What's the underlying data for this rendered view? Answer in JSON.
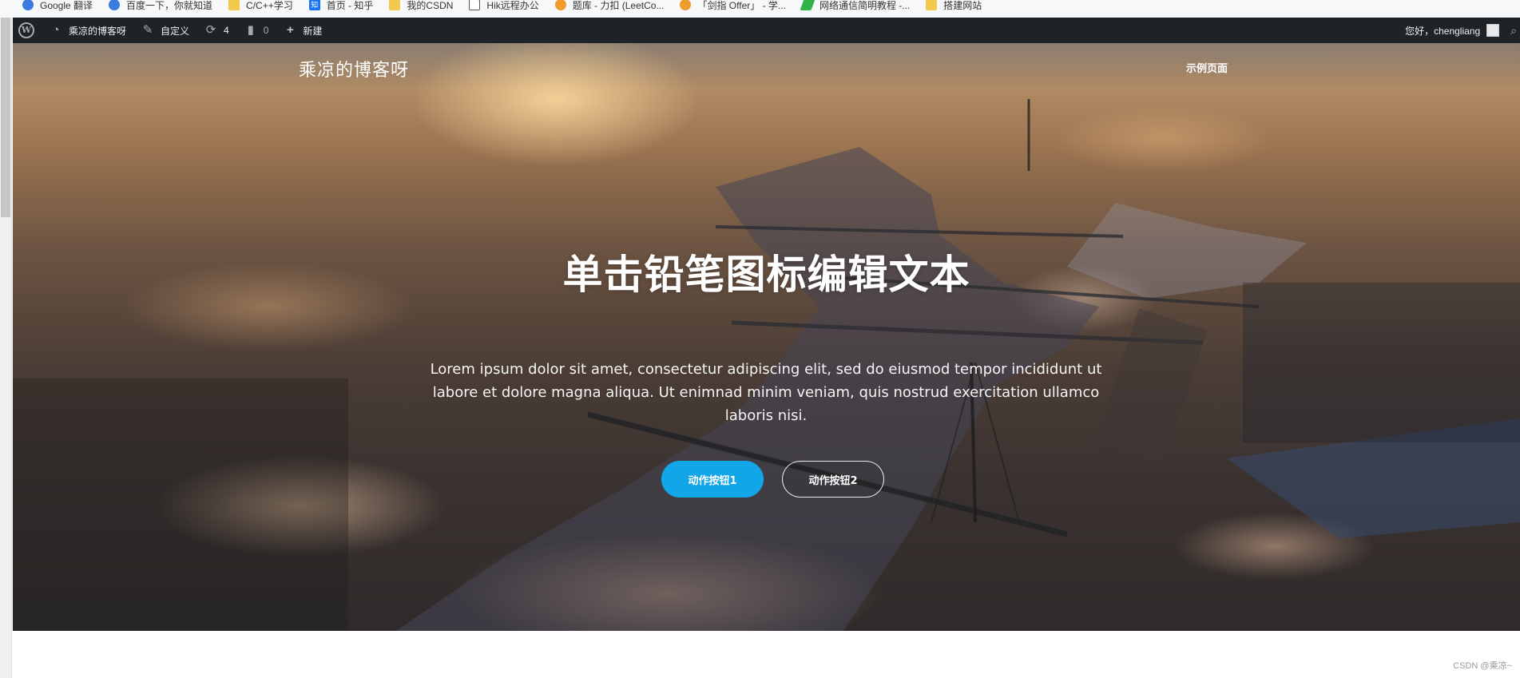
{
  "bookmarks": [
    {
      "label": "Google 翻译",
      "icon": "google-translate-icon"
    },
    {
      "label": "百度一下，你就知道",
      "icon": "baidu-icon"
    },
    {
      "label": "C/C++学习",
      "icon": "folder-icon"
    },
    {
      "label": "首页 - 知乎",
      "icon": "zhihu-icon"
    },
    {
      "label": "我的CSDN",
      "icon": "folder-icon"
    },
    {
      "label": "Hik远程办公",
      "icon": "document-icon"
    },
    {
      "label": "题库 - 力扣 (LeetCo...",
      "icon": "leetcode-icon"
    },
    {
      "label": "「剑指 Offer」 - 学...",
      "icon": "leetcode-icon"
    },
    {
      "label": "网络通信简明教程 -...",
      "icon": "leaf-icon"
    },
    {
      "label": "搭建网站",
      "icon": "folder-icon"
    }
  ],
  "adminbar": {
    "site_name": "乘凉的博客呀",
    "customize": "自定义",
    "updates_count": "4",
    "comments_count": "0",
    "new_label": "新建",
    "greeting": "您好，chengliang"
  },
  "hero": {
    "site_title": "乘凉的博客呀",
    "nav_link": "示例页面",
    "headline": "单击铅笔图标编辑文本",
    "subtext": "Lorem ipsum dolor sit amet, consectetur adipiscing elit, sed do eiusmod tempor incididunt ut labore et dolore magna aliqua. Ut enimnad minim veniam, quis nostrud exercitation ullamco laboris nisi.",
    "button_1": "动作按钮1",
    "button_2": "动作按钮2",
    "accent_color": "#12a6e8"
  },
  "watermark": "CSDN @乘凉~"
}
